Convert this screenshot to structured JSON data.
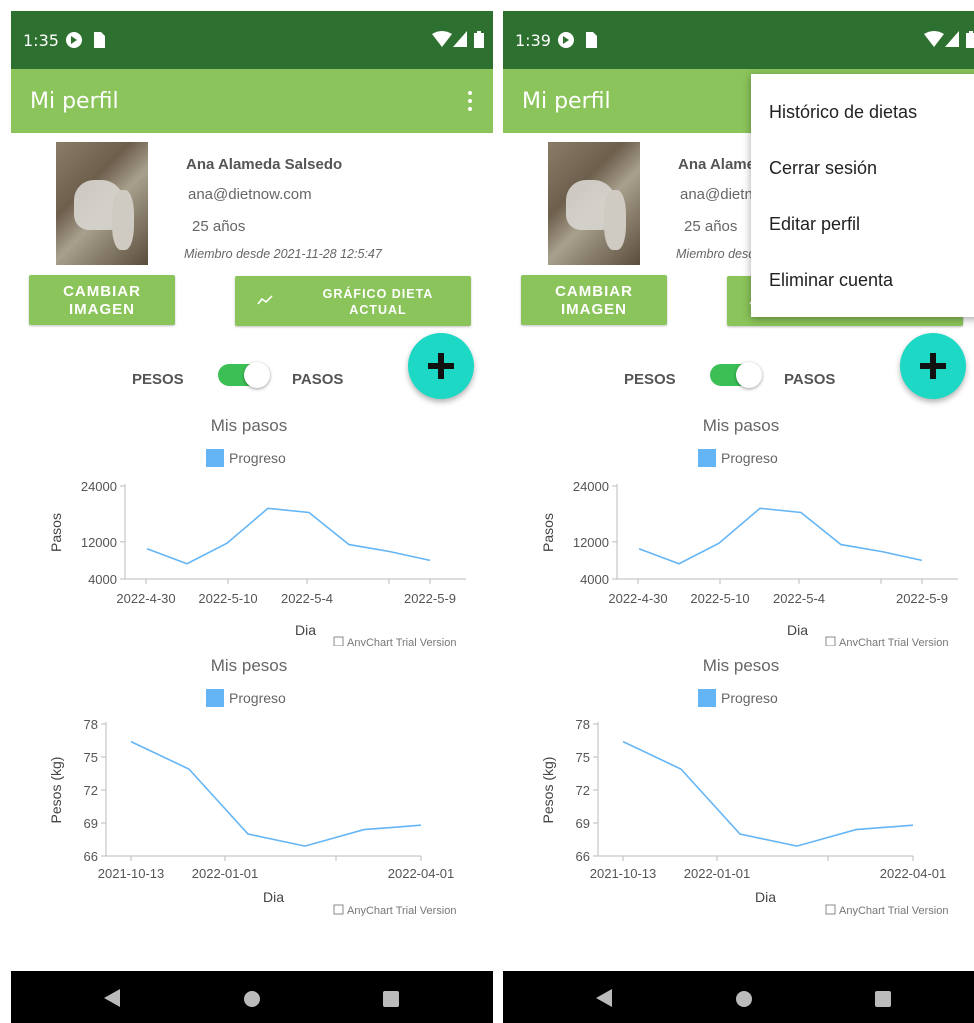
{
  "screens": [
    {
      "time": "1:35"
    },
    {
      "time": "1:39"
    }
  ],
  "appbar": {
    "title": "Mi perfil"
  },
  "profile": {
    "name": "Ana Alameda Salsedo",
    "email": "ana@dietnow.com",
    "age": "25 años",
    "member_since": "Miembro desde 2021-11-28 12:5:47"
  },
  "buttons": {
    "change_image_line1": "CAMBIAR",
    "change_image_line2": "IMAGEN",
    "chart_diet_line1": "GRÁFICO DIETA",
    "chart_diet_line2": "ACTUAL"
  },
  "toggle": {
    "left_label": "PESOS",
    "right_label": "PASOS",
    "state": "on"
  },
  "menu": {
    "items": [
      "Histórico de dietas",
      "Cerrar sesión",
      "Editar perfil",
      "Eliminar cuenta"
    ]
  },
  "colors": {
    "status_bar": "#2e7030",
    "app_bar": "#8bc45a",
    "fab": "#1dd8c4",
    "line": "#64b5f6",
    "switch_on": "#3cbf55"
  },
  "icons": [
    "sim-card-icon",
    "wifi-icon",
    "signal-icon",
    "battery-icon",
    "kebab-menu-icon",
    "trending-icon",
    "plus-icon",
    "back-icon",
    "home-icon",
    "recents-icon"
  ],
  "credit": "AnyChart Trial Version",
  "chart_data": [
    {
      "type": "line",
      "title": "Mis pasos",
      "legend": "Progreso",
      "xlabel": "Dia",
      "ylabel": "Pasos",
      "ylim": [
        4000,
        24000
      ],
      "yticks": [
        "24000",
        "12000",
        "4000"
      ],
      "xticks": [
        "2022-4-30",
        "2022-5-10",
        "2022-5-4",
        "2022-5-9"
      ],
      "x": [
        "2022-4-30",
        "",
        "2022-5-10",
        "",
        "2022-5-4",
        "",
        "",
        "2022-5-9"
      ],
      "series": [
        {
          "name": "Progreso",
          "values": [
            10500,
            7300,
            11700,
            19200,
            18300,
            11400,
            9900,
            8000
          ]
        }
      ]
    },
    {
      "type": "line",
      "title": "Mis pesos",
      "legend": "Progreso",
      "xlabel": "Dia",
      "ylabel": "Pesos (kg)",
      "ylim": [
        66,
        78
      ],
      "yticks": [
        "78",
        "75",
        "72",
        "69",
        "66"
      ],
      "xticks": [
        "2021-10-13",
        "2022-01-01",
        "2022-04-01"
      ],
      "series": [
        {
          "name": "Progreso",
          "values": [
            76.4,
            73.9,
            68.0,
            66.9,
            68.4,
            68.8
          ]
        }
      ]
    }
  ]
}
